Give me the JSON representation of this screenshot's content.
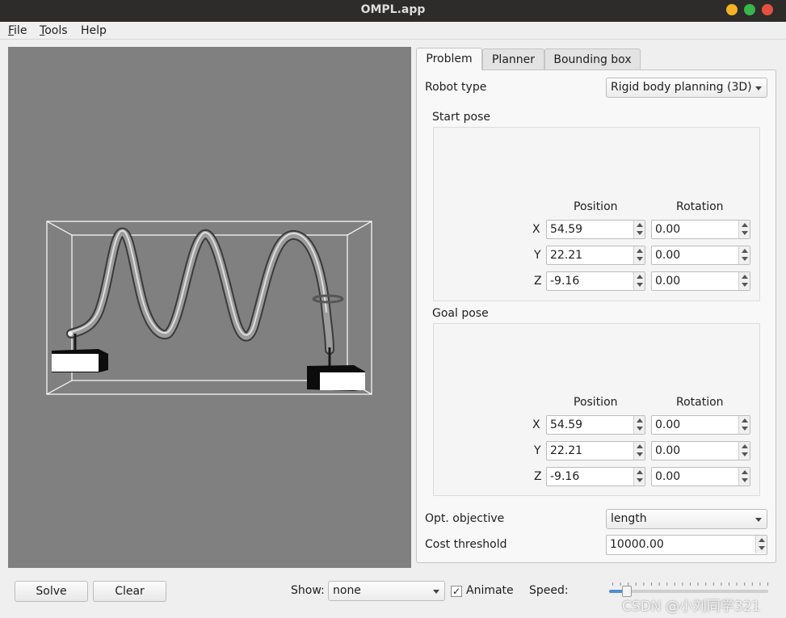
{
  "window": {
    "title": "OMPL.app",
    "buttons": {
      "minimize_color": "#f5b324",
      "maximize_color": "#39b54a",
      "close_color": "#e45040"
    }
  },
  "menu": {
    "file": {
      "mnemonic": "F",
      "rest": "ile"
    },
    "tools": {
      "mnemonic": "T",
      "rest": "ools"
    },
    "help": "Help"
  },
  "viewport": {
    "background": "#808080"
  },
  "tabs": [
    {
      "label": "Problem",
      "active": true
    },
    {
      "label": "Planner",
      "active": false
    },
    {
      "label": "Bounding box",
      "active": false
    }
  ],
  "problem": {
    "robot_type_label": "Robot type",
    "robot_type_value": "Rigid body planning (3D)",
    "start_pose": {
      "title": "Start pose",
      "position_header": "Position",
      "rotation_header": "Rotation",
      "rows": [
        {
          "axis": "X",
          "position": "54.59",
          "rotation": "0.00"
        },
        {
          "axis": "Y",
          "position": "22.21",
          "rotation": "0.00"
        },
        {
          "axis": "Z",
          "position": "-9.16",
          "rotation": "0.00"
        }
      ]
    },
    "goal_pose": {
      "title": "Goal pose",
      "position_header": "Position",
      "rotation_header": "Rotation",
      "rows": [
        {
          "axis": "X",
          "position": "54.59",
          "rotation": "0.00"
        },
        {
          "axis": "Y",
          "position": "22.21",
          "rotation": "0.00"
        },
        {
          "axis": "Z",
          "position": "-9.16",
          "rotation": "0.00"
        }
      ]
    },
    "opt_objective_label": "Opt. objective",
    "opt_objective_value": "length",
    "cost_threshold_label": "Cost threshold",
    "cost_threshold_value": "10000.00"
  },
  "bottom": {
    "solve_label": "Solve",
    "clear_label": "Clear",
    "show_label": "Show:",
    "show_value": "none",
    "animate_label": "Animate",
    "animate_checked": true,
    "check_mark": "✓",
    "speed_label": "Speed:",
    "speed_level": 0.1
  },
  "watermark": "CSDN @小刘同学321"
}
